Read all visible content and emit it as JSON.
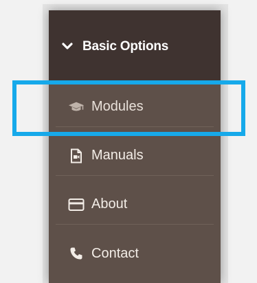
{
  "colors": {
    "panel_bg": "#5e5049",
    "header_bg": "#3f3330",
    "text": "#f3ede7",
    "highlight_border": "#16a9ea"
  },
  "menu": {
    "header": {
      "title": "Basic Options",
      "icon": "chevron-down-icon"
    },
    "items": [
      {
        "label": "Modules",
        "icon": "graduation-cap-icon"
      },
      {
        "label": "Manuals",
        "icon": "document-icon"
      },
      {
        "label": "About",
        "icon": "card-icon"
      },
      {
        "label": "Contact",
        "icon": "phone-icon"
      }
    ]
  }
}
